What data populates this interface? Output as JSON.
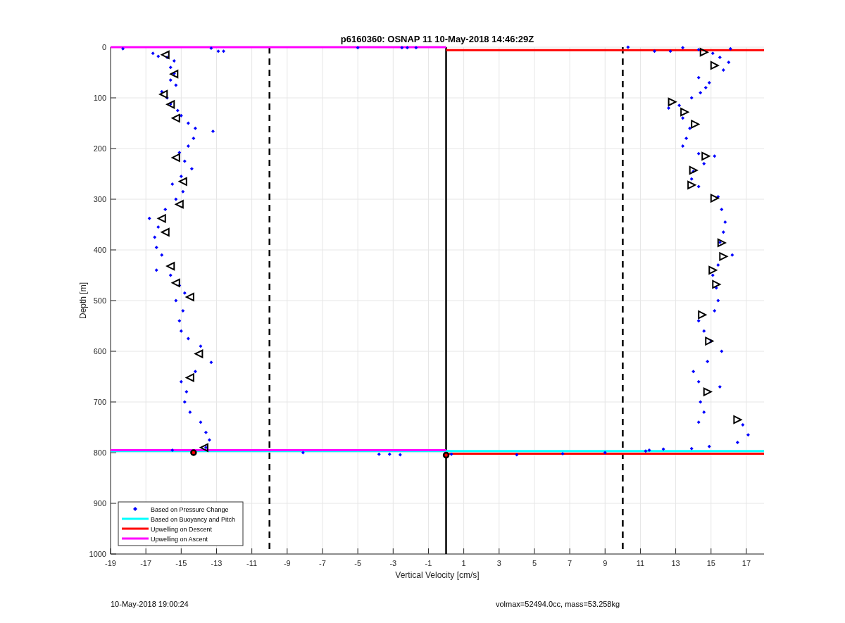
{
  "chart_data": {
    "type": "scatter",
    "title": "p6160360: OSNAP 11 10-May-2018 14:46:29Z",
    "xlabel": "Vertical Velocity [cm/s]",
    "ylabel": "Depth [m]",
    "xlim": [
      -19,
      18
    ],
    "ylim": [
      1000,
      0
    ],
    "xticks": [
      -19,
      -17,
      -15,
      -13,
      -11,
      -9,
      -7,
      -5,
      -3,
      -1,
      1,
      3,
      5,
      7,
      9,
      11,
      13,
      15,
      17
    ],
    "yticks": [
      0,
      100,
      200,
      300,
      400,
      500,
      600,
      700,
      800,
      900,
      1000
    ],
    "series": [
      {
        "name": "Based on Pressure Change",
        "type": "scatter",
        "marker": "diamond",
        "color": "#0000ff",
        "x": [
          -18.3,
          -13.3,
          -12.9,
          -12.6,
          -16.6,
          -16.3,
          -15.8,
          -15.4,
          -15.6,
          -15.4,
          -15.6,
          -15.3,
          -16.1,
          -15.8,
          -15.6,
          -15.2,
          -15.0,
          -14.6,
          -14.2,
          -13.2,
          -14.3,
          -14.6,
          -15.1,
          -14.8,
          -14.4,
          -15.0,
          -15.5,
          -14.9,
          -15.3,
          -15.9,
          -16.8,
          -16.3,
          -16.5,
          -16.4,
          -16.1,
          -16.4,
          -15.6,
          -15.1,
          -14.8,
          -15.3,
          -14.9,
          -15.1,
          -15.0,
          -14.6,
          -13.9,
          -13.3,
          -14.2,
          -15.0,
          -14.7,
          -14.8,
          -14.5,
          -13.9,
          -13.6,
          -13.4,
          -13.6,
          -15.5,
          -8.1,
          -3.8,
          -3.2,
          -2.6,
          0.3,
          4.0,
          6.6,
          9.0,
          -5.0,
          -2.5,
          -2.2,
          -1.7,
          10.3,
          11.8,
          12.7,
          13.4,
          14.3,
          15.1,
          15.5,
          16.1,
          16.0,
          15.7,
          14.3,
          14.9,
          14.7,
          14.4,
          13.9,
          13.2,
          12.6,
          13.4,
          13.8,
          13.6,
          13.4,
          14.3,
          15.2,
          14.6,
          14.0,
          13.9,
          14.3,
          15.4,
          15.6,
          15.8,
          15.7,
          15.5,
          16.2,
          15.4,
          15.1,
          15.3,
          15.4,
          15.2,
          14.3,
          14.6,
          15.0,
          15.6,
          14.8,
          14.0,
          14.3,
          15.5,
          14.4,
          14.6,
          14.3,
          16.8,
          17.1,
          16.5,
          14.9,
          13.9,
          12.3,
          11.5,
          11.3
        ],
        "values": [
          3,
          2,
          8,
          8,
          12,
          18,
          20,
          27,
          40,
          52,
          65,
          75,
          88,
          100,
          112,
          125,
          135,
          150,
          160,
          166,
          180,
          195,
          208,
          225,
          240,
          255,
          270,
          285,
          300,
          320,
          338,
          355,
          375,
          395,
          410,
          440,
          450,
          470,
          485,
          500,
          520,
          540,
          560,
          575,
          590,
          622,
          640,
          660,
          680,
          700,
          720,
          740,
          760,
          775,
          790,
          795,
          800,
          803,
          803,
          804,
          803,
          804,
          802,
          800,
          1,
          1,
          1,
          1,
          0,
          8,
          8,
          1,
          5,
          12,
          20,
          3,
          30,
          45,
          60,
          70,
          80,
          90,
          100,
          115,
          120,
          140,
          160,
          180,
          195,
          210,
          215,
          230,
          245,
          260,
          275,
          295,
          320,
          345,
          365,
          385,
          410,
          430,
          450,
          475,
          500,
          520,
          540,
          560,
          580,
          600,
          620,
          640,
          660,
          670,
          700,
          720,
          740,
          745,
          765,
          780,
          788,
          792,
          793,
          795,
          797
        ]
      },
      {
        "type": "scatter",
        "marker": "triangle",
        "color": "#000000",
        "x": [
          -15.9,
          -15.4,
          -16.0,
          -15.6,
          -15.3,
          -15.3,
          -14.9,
          -15.1,
          -16.1,
          -15.9,
          -15.6,
          -15.3,
          -14.5,
          -14.0,
          -14.5,
          -13.7,
          14.6,
          15.2,
          12.8,
          13.5,
          14.1,
          14.7,
          14.0,
          13.9,
          15.2,
          15.6,
          15.7,
          15.1,
          15.3,
          14.5,
          14.9,
          14.8,
          16.5
        ],
        "values": [
          15,
          53,
          93,
          113,
          140,
          218,
          265,
          310,
          338,
          365,
          432,
          465,
          493,
          605,
          652,
          790,
          10,
          36,
          108,
          128,
          152,
          215,
          243,
          272,
          298,
          386,
          413,
          440,
          468,
          528,
          580,
          680,
          735
        ]
      },
      {
        "type": "scatter",
        "marker": "circle",
        "color": "#000000",
        "x": [
          -14.3,
          0.0
        ],
        "values": [
          800,
          805
        ]
      },
      {
        "type": "line",
        "line_style": "solid",
        "color": "#000000",
        "x": [
          0,
          0
        ],
        "values": [
          0,
          1000
        ]
      },
      {
        "type": "line",
        "line_style": "dashed",
        "color": "#000000",
        "x": [
          -10,
          -10
        ],
        "values": [
          0,
          1000
        ]
      },
      {
        "type": "line",
        "line_style": "dashed",
        "color": "#000000",
        "x": [
          10,
          10
        ],
        "values": [
          0,
          1000
        ]
      },
      {
        "name": "Based on Buoyancy and Pitch",
        "type": "line",
        "line_style": "solid",
        "color": "#00ffff",
        "x": [
          -19,
          18
        ],
        "values": [
          797,
          797
        ]
      },
      {
        "name": "Upwelling on Descent",
        "type": "line",
        "line_style": "solid",
        "color": "#ff0000",
        "x": [
          0,
          18
        ],
        "values": [
          6,
          6
        ]
      },
      {
        "type": "line",
        "line_style": "solid",
        "color": "#ff0000",
        "x": [
          0,
          18
        ],
        "values": [
          802,
          802
        ]
      },
      {
        "name": "Upwelling on Ascent",
        "type": "line",
        "line_style": "solid",
        "color": "#ff00ff",
        "x": [
          -19,
          0
        ],
        "values": [
          0,
          0
        ]
      },
      {
        "type": "line",
        "line_style": "solid",
        "color": "#ff00ff",
        "x": [
          -19,
          0
        ],
        "values": [
          795,
          795
        ]
      }
    ],
    "grid": true,
    "legend": true
  },
  "footer": {
    "left": "10-May-2018 19:00:24",
    "right": "volmax=52494.0cc, mass=53.258kg"
  }
}
